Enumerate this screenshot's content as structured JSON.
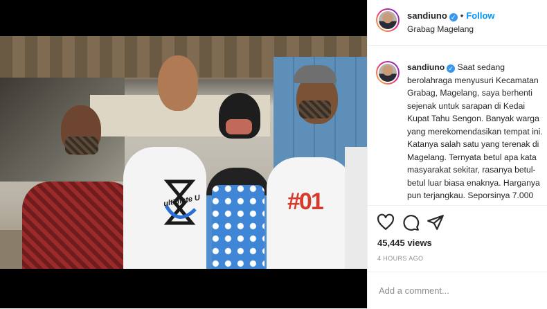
{
  "post": {
    "username": "sandiuno",
    "follow_label": "Follow",
    "separator": "•",
    "location": "Grabag Magelang",
    "caption_username": "sandiuno",
    "caption": "Saat sedang berolahraga menyusuri Kecamatan Grabag, Magelang, saya berhenti sejenak untuk sarapan di Kedai Kupat Tahu Sengon. Banyak warga yang merekomendasikan tempat ini. Katanya salah satu yang terenak di Magelang. Ternyata betul apa kata masyarakat sekitar, rasanya betul-betul luar biasa enaknya. Harganya pun terjangkau. Seporsinya 7.000",
    "views": "45,445 views",
    "timestamp": "4 HOURS AGO",
    "comment_placeholder": "Add a comment..."
  },
  "video": {
    "shirt_text": "ultimate U",
    "shirt_number": "#01"
  },
  "colors": {
    "link_blue": "#0095f6",
    "verified_blue": "#3897f0",
    "text": "#262626",
    "muted": "#8e8e8e"
  },
  "icons": [
    "verified-icon",
    "heart-icon",
    "comment-icon",
    "share-icon"
  ]
}
